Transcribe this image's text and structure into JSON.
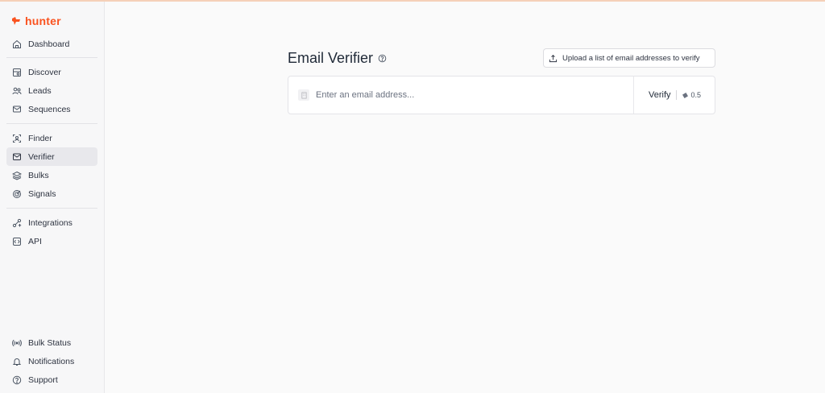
{
  "brand": {
    "name": "hunter",
    "color": "#fa5320"
  },
  "sidebar": {
    "items": [
      {
        "label": "Dashboard",
        "icon": "home-icon"
      },
      {
        "label": "Discover",
        "icon": "discover-icon"
      },
      {
        "label": "Leads",
        "icon": "leads-icon"
      },
      {
        "label": "Sequences",
        "icon": "sequences-icon"
      },
      {
        "label": "Finder",
        "icon": "finder-icon"
      },
      {
        "label": "Verifier",
        "icon": "mail-check-icon",
        "active": true
      },
      {
        "label": "Bulks",
        "icon": "layers-icon"
      },
      {
        "label": "Signals",
        "icon": "target-icon"
      },
      {
        "label": "Integrations",
        "icon": "plug-icon"
      },
      {
        "label": "API",
        "icon": "api-icon"
      },
      {
        "label": "Bulk Status",
        "icon": "broadcast-icon"
      },
      {
        "label": "Notifications",
        "icon": "bell-icon"
      },
      {
        "label": "Support",
        "icon": "help-circle-icon"
      }
    ]
  },
  "main": {
    "title": "Email Verifier",
    "upload_label": "Upload a list of email addresses to verify",
    "input": {
      "placeholder": "Enter an email address...",
      "value": ""
    },
    "verify_label": "Verify",
    "credit_cost": "0.5"
  }
}
